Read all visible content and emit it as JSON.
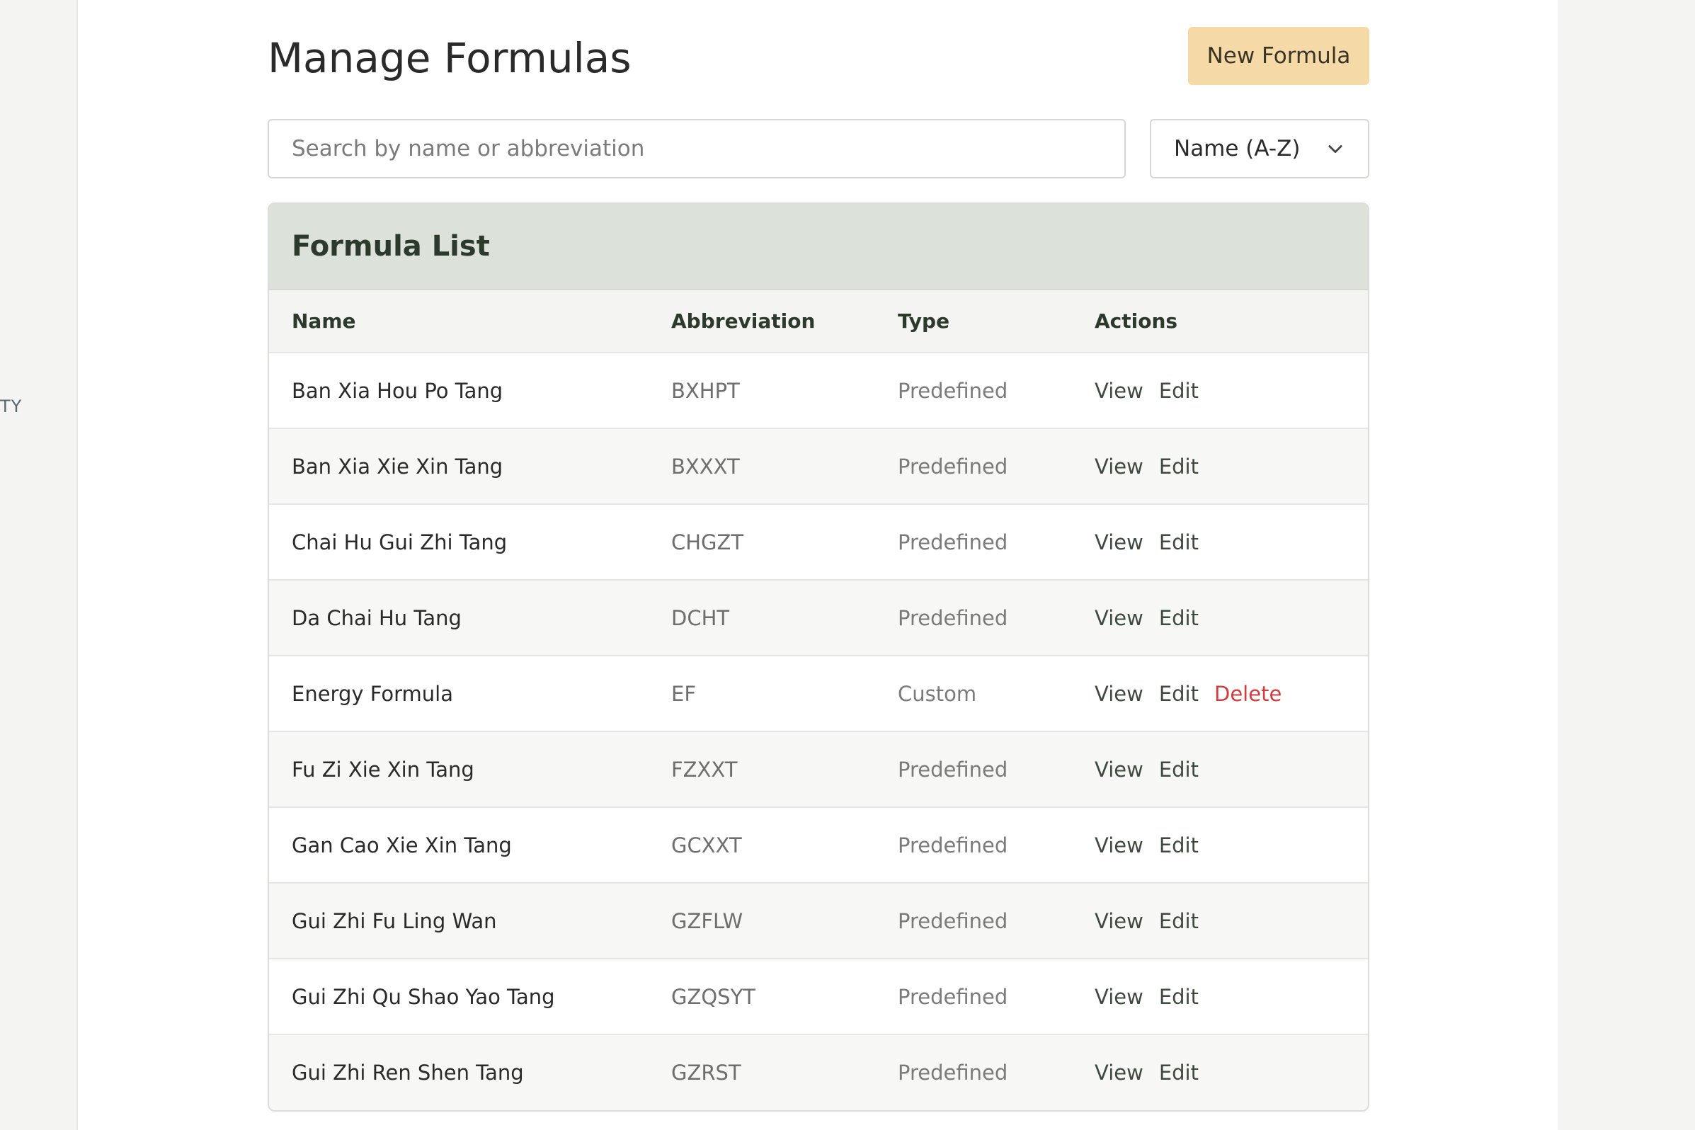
{
  "sidebar": {
    "fragment_text": "TY"
  },
  "page": {
    "title": "Manage Formulas",
    "new_button_label": "New Formula"
  },
  "search": {
    "placeholder": "Search by name or abbreviation",
    "value": ""
  },
  "sort": {
    "selected": "Name (A-Z)",
    "icon": "chevron-down-icon"
  },
  "card": {
    "title": "Formula List"
  },
  "table": {
    "columns": [
      "Name",
      "Abbreviation",
      "Type",
      "Actions"
    ],
    "rows": [
      {
        "name": "Ban Xia Hou Po Tang",
        "abbr": "BXHPT",
        "type": "Predefined",
        "actions": [
          "View",
          "Edit"
        ]
      },
      {
        "name": "Ban Xia Xie Xin Tang",
        "abbr": "BXXXT",
        "type": "Predefined",
        "actions": [
          "View",
          "Edit"
        ]
      },
      {
        "name": "Chai Hu Gui Zhi Tang",
        "abbr": "CHGZT",
        "type": "Predefined",
        "actions": [
          "View",
          "Edit"
        ]
      },
      {
        "name": "Da Chai Hu Tang",
        "abbr": "DCHT",
        "type": "Predefined",
        "actions": [
          "View",
          "Edit"
        ]
      },
      {
        "name": "Energy Formula",
        "abbr": "EF",
        "type": "Custom",
        "actions": [
          "View",
          "Edit",
          "Delete"
        ]
      },
      {
        "name": "Fu Zi Xie Xin Tang",
        "abbr": "FZXXT",
        "type": "Predefined",
        "actions": [
          "View",
          "Edit"
        ]
      },
      {
        "name": "Gan Cao Xie Xin Tang",
        "abbr": "GCXXT",
        "type": "Predefined",
        "actions": [
          "View",
          "Edit"
        ]
      },
      {
        "name": "Gui Zhi Fu Ling Wan",
        "abbr": "GZFLW",
        "type": "Predefined",
        "actions": [
          "View",
          "Edit"
        ]
      },
      {
        "name": "Gui Zhi Qu Shao Yao Tang",
        "abbr": "GZQSYT",
        "type": "Predefined",
        "actions": [
          "View",
          "Edit"
        ]
      },
      {
        "name": "Gui Zhi Ren Shen Tang",
        "abbr": "GZRST",
        "type": "Predefined",
        "actions": [
          "View",
          "Edit"
        ]
      }
    ]
  },
  "colors": {
    "accent_button": "#f5d9a6",
    "card_header": "#dce1da",
    "delete": "#d23c3c"
  }
}
